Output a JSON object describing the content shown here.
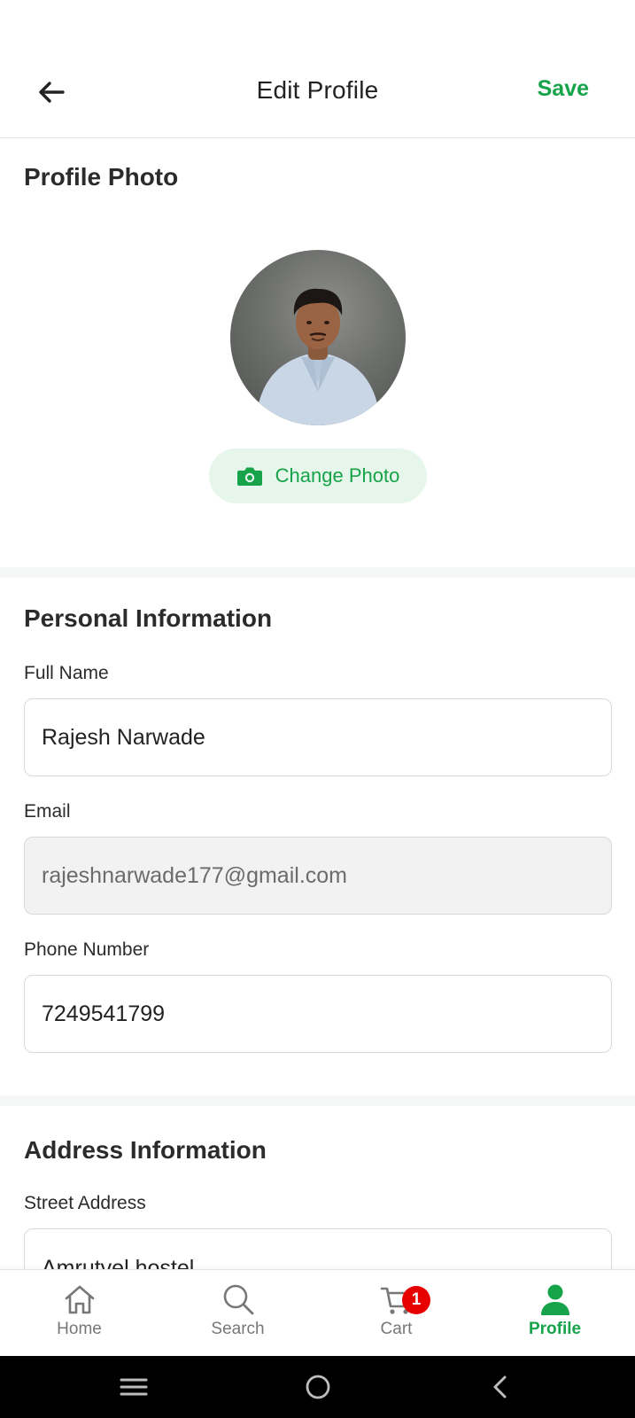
{
  "header": {
    "title": "Edit Profile",
    "save_label": "Save"
  },
  "photo_section": {
    "title": "Profile Photo",
    "change_photo_label": "Change Photo"
  },
  "personal_section": {
    "title": "Personal Information",
    "full_name_label": "Full Name",
    "full_name_value": "Rajesh Narwade",
    "email_label": "Email",
    "email_value": "rajeshnarwade177@gmail.com",
    "phone_label": "Phone Number",
    "phone_value": "7249541799"
  },
  "address_section": {
    "title": "Address Information",
    "street_label": "Street Address",
    "street_value": "Amrutvel hostel"
  },
  "bottom_nav": {
    "items": [
      {
        "label": "Home",
        "icon": "home-icon",
        "active": false
      },
      {
        "label": "Search",
        "icon": "search-icon",
        "active": false
      },
      {
        "label": "Cart",
        "icon": "cart-icon",
        "active": false,
        "badge": "1"
      },
      {
        "label": "Profile",
        "icon": "person-icon",
        "active": true
      }
    ]
  },
  "colors": {
    "accent": "#16a34a",
    "accent_light": "#e6f6ea",
    "badge": "#e60000"
  }
}
